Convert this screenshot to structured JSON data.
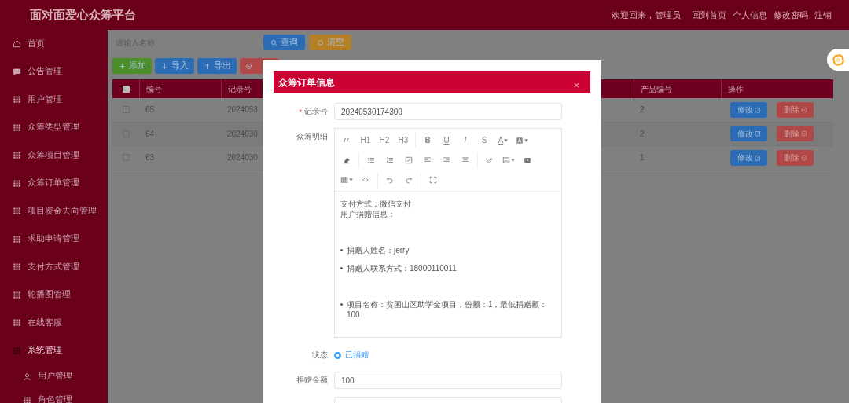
{
  "header": {
    "title": "面对面爱心众筹平台",
    "links": [
      "欢迎回来，管理员",
      "回到首页",
      "个人信息",
      "修改密码",
      "注销"
    ]
  },
  "sidebar": {
    "items": [
      {
        "label": "首页",
        "kind": "home",
        "expanded": false
      },
      {
        "label": "公告管理",
        "kind": "chat",
        "expanded": false
      },
      {
        "label": "用户管理",
        "kind": "grid",
        "expanded": false
      },
      {
        "label": "众筹类型管理",
        "kind": "grid",
        "expanded": false
      },
      {
        "label": "众筹项目管理",
        "kind": "grid",
        "expanded": false
      },
      {
        "label": "众筹订单管理",
        "kind": "grid",
        "expanded": false
      },
      {
        "label": "项目资金去向管理",
        "kind": "grid",
        "expanded": false
      },
      {
        "label": "求助申请管理",
        "kind": "grid",
        "expanded": false
      },
      {
        "label": "支付方式管理",
        "kind": "grid",
        "expanded": false
      },
      {
        "label": "轮播图管理",
        "kind": "grid",
        "expanded": false
      },
      {
        "label": "在线客服",
        "kind": "grid",
        "expanded": false
      },
      {
        "label": "系统管理",
        "kind": "grid",
        "expanded": true,
        "children": [
          {
            "label": "用户管理",
            "kind": "user"
          },
          {
            "label": "角色管理",
            "kind": "grid"
          }
        ]
      }
    ]
  },
  "search": {
    "placeholder": "请输入名称",
    "buttons": [
      {
        "kind": "query",
        "label": "查询"
      },
      {
        "kind": "clear",
        "label": "清空"
      }
    ]
  },
  "toolbar": [
    {
      "kind": "add",
      "label": "添加"
    },
    {
      "kind": "import",
      "label": "导入"
    },
    {
      "kind": "export",
      "label": "导出"
    },
    {
      "kind": "delete"
    }
  ],
  "table": {
    "all_checked": false,
    "columns": [
      "编号",
      "记录号",
      "产品编号",
      "操作"
    ],
    "rows": [
      {
        "checked": false,
        "id": "65",
        "record": "2024053",
        "product": "2",
        "actions": [
          "修改",
          "删除"
        ]
      },
      {
        "checked": false,
        "id": "64",
        "record": "2024030",
        "product": "2",
        "actions": [
          "修改",
          "删除"
        ]
      },
      {
        "checked": false,
        "id": "63",
        "record": "2024030",
        "product": "1",
        "actions": [
          "修改",
          "删除"
        ]
      }
    ]
  },
  "dialog": {
    "title": "众筹订单信息",
    "close": "×",
    "record": {
      "required_mark": "*",
      "label": "记录号",
      "value": "20240530174300"
    },
    "detail": {
      "label": "众筹明细",
      "toolbar": [
        [
          [
            {
              "kind": "quote"
            },
            {
              "kind": "text",
              "label": "H1"
            },
            {
              "kind": "text",
              "label": "H2"
            },
            {
              "kind": "text",
              "label": "H3"
            }
          ],
          [
            {
              "kind": "bold",
              "label": "B"
            },
            {
              "kind": "underline",
              "label": "U"
            },
            {
              "kind": "italic",
              "label": "I"
            },
            {
              "kind": "strike",
              "label": "S"
            },
            {
              "kind": "color",
              "label": "A"
            },
            {
              "kind": "bgcolor"
            }
          ]
        ],
        [
          [
            {
              "kind": "eraser"
            }
          ],
          [
            {
              "kind": "bullets"
            },
            {
              "kind": "numbers"
            },
            {
              "kind": "todo"
            },
            {
              "kind": "align-left"
            },
            {
              "kind": "align-right"
            },
            {
              "kind": "align-center"
            }
          ],
          [
            {
              "kind": "link"
            },
            {
              "kind": "image"
            },
            {
              "kind": "video"
            }
          ]
        ],
        [
          [
            {
              "kind": "table"
            },
            {
              "kind": "code"
            }
          ],
          [
            {
              "kind": "undo"
            },
            {
              "kind": "redo"
            }
          ],
          [
            {
              "kind": "fullscreen"
            }
          ]
        ]
      ],
      "content": [
        {
          "kind": "p",
          "text": "支付方式：微信支付"
        },
        {
          "kind": "p",
          "text": "用户捐赠信息："
        },
        {
          "kind": "blank"
        },
        {
          "kind": "li",
          "text": "捐赠人姓名：jerry"
        },
        {
          "kind": "li",
          "text": "捐赠人联系方式：18000110011"
        },
        {
          "kind": "blank"
        },
        {
          "kind": "li",
          "text": "项目名称：贫困山区助学金项目，份额：1，最低捐赠额：100"
        }
      ]
    },
    "status": {
      "label": "状态",
      "options": [
        {
          "label": "已捐赠",
          "selected": true
        }
      ]
    },
    "amount": {
      "label": "捐赠金额",
      "value": "100"
    }
  }
}
